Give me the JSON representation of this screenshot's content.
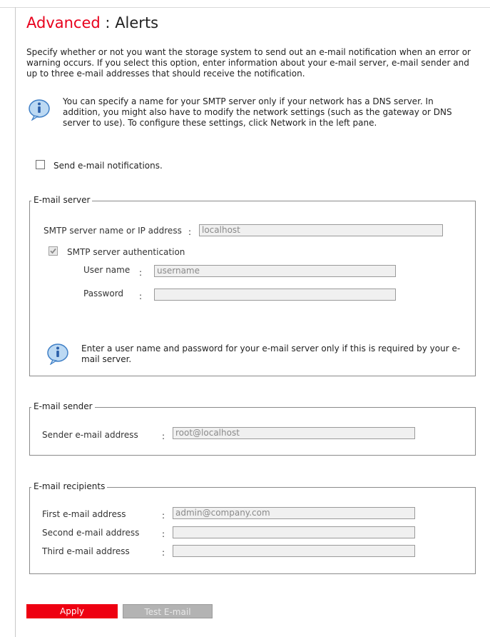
{
  "header": {
    "title_part1": "Advanced",
    "separator": ":",
    "title_part2": "Alerts"
  },
  "intro": "Specify whether or not you want the storage system to send out an e-mail notification when an error or warning occurs. If you select this option, enter information about your e-mail server, e-mail sender and up to three e-mail addresses that should receive the notification.",
  "info_top": "You can specify a name for your SMTP server only if your network has a DNS server. In addition, you might also have to modify the network settings (such as the gateway or DNS server to use). To configure these settings, click Network in the left pane.",
  "send_notifications": {
    "label": "Send e-mail notifications.",
    "checked": false
  },
  "email_server": {
    "legend": "E-mail server",
    "smtp_label": "SMTP server name or IP address",
    "smtp_value": "localhost",
    "auth_label": "SMTP server authentication",
    "auth_checked": true,
    "username_label": "User name",
    "username_value": "username",
    "password_label": "Password",
    "password_value": "",
    "info": "Enter a user name and password for your e-mail server only if this is required by your e-mail server."
  },
  "email_sender": {
    "legend": "E-mail sender",
    "sender_label": "Sender e-mail address",
    "sender_value": "root@localhost"
  },
  "email_recipients": {
    "legend": "E-mail recipients",
    "first_label": "First e-mail address",
    "first_value": "admin@company.com",
    "second_label": "Second e-mail address",
    "second_value": "",
    "third_label": "Third e-mail address",
    "third_value": ""
  },
  "colon": ":",
  "buttons": {
    "apply": "Apply",
    "test": "Test E-mail"
  },
  "colors": {
    "accent": "#ee0011",
    "title_red": "#e8001c",
    "disabled_button": "#b3b3b3"
  },
  "icons": {
    "info": "info-icon"
  }
}
